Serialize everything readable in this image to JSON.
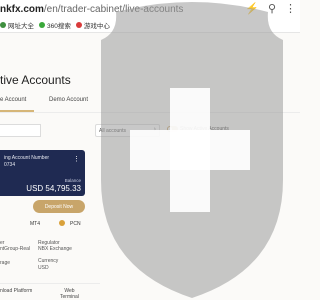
{
  "browser": {
    "url_host": "nkfx.com",
    "url_path": "/en/trader-cabinet/live-accounts",
    "bookmarks": [
      {
        "label": "网址大全",
        "color": "#3f8f3f"
      },
      {
        "label": "360搜索",
        "color": "#3aa83a"
      },
      {
        "label": "游戏中心",
        "color": "#d93b3b"
      }
    ]
  },
  "page": {
    "title": "tive Accounts",
    "tabs": [
      {
        "label": "e Account",
        "active": true
      },
      {
        "label": "Demo Account",
        "active": false
      }
    ]
  },
  "filters": {
    "select_value": "All accounts",
    "toggle_label": "Show Active Accounts",
    "toggle_on": true
  },
  "account_card": {
    "number_label": "ing Account Number",
    "number": "0734",
    "balance_label": "Balance",
    "balance": "USD 54,795.33",
    "deposit_label": "Deposit Now"
  },
  "platforms": {
    "left_label": "MT4",
    "right_label": "PCN"
  },
  "details": {
    "server_label": "er",
    "server_value": "ntGroup-Real",
    "regulator_label": "Regulator",
    "regulator_value": "NBX Exchange",
    "leverage_label": "rage",
    "currency_label": "Currency",
    "currency_value": "USD"
  },
  "footer": {
    "left_label": "nload Platform",
    "right_line1": "Web",
    "right_line2": "Terminal"
  },
  "colors": {
    "card_bg": "#1f2a52",
    "accent_gold": "#c8a56a",
    "shield": "#9a9a9a"
  },
  "overlay": {
    "icon": "shield-plus-icon"
  }
}
